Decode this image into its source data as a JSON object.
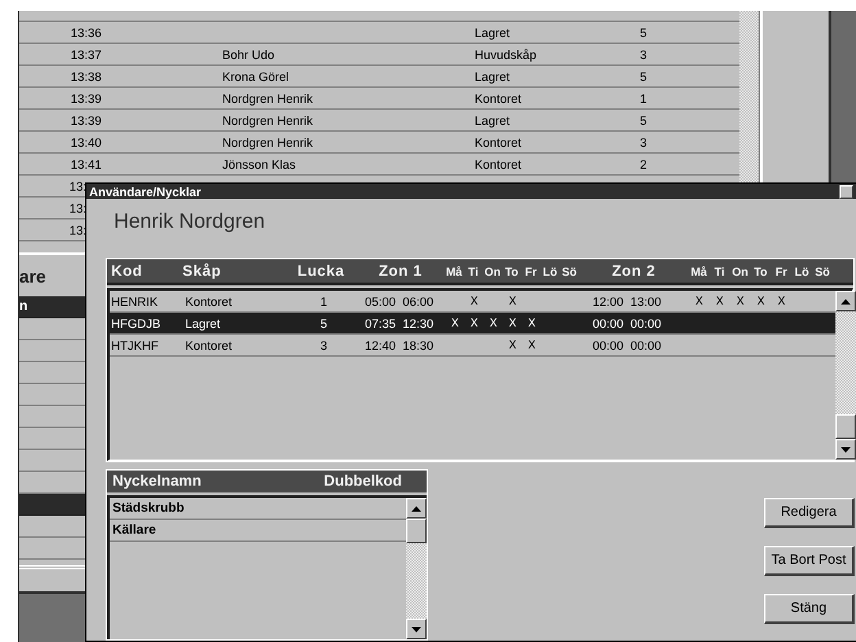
{
  "log_rows": [
    {
      "time": "13:36",
      "place": "Lagret",
      "number": "5"
    },
    {
      "time": "13:37",
      "name": "Bohr Udo",
      "place": "Huvudskåp",
      "number": "3"
    },
    {
      "time": "13:38",
      "name": "Krona Görel",
      "place": "Lagret",
      "number": "5"
    },
    {
      "time": "13:39",
      "name": "Nordgren Henrik",
      "place": "Kontoret",
      "number": "1"
    },
    {
      "time": "13:39",
      "name": "Nordgren Henrik",
      "place": "Lagret",
      "number": "5"
    },
    {
      "time": "13:40",
      "name": "Nordgren Henrik",
      "place": "Kontoret",
      "number": "3"
    },
    {
      "time": "13:41",
      "name": "Jönsson Klas",
      "place": "Kontoret",
      "number": "2"
    }
  ],
  "log_partial_rows": [
    "13:",
    "13:",
    "13:"
  ],
  "side_panel": {
    "title": "are",
    "items": [
      {
        "label": "n",
        "selected": true
      },
      {
        "selected": false
      },
      {
        "selected": false
      },
      {
        "selected": false
      },
      {
        "selected": false
      },
      {
        "selected": false
      },
      {
        "selected": false
      },
      {
        "selected": false
      },
      {
        "selected": false
      },
      {
        "selected": true
      },
      {
        "selected": false
      },
      {
        "selected": false
      }
    ]
  },
  "dialog": {
    "title": "Användare/Nycklar",
    "user_name": "Henrik Nordgren",
    "keys_table": {
      "header": {
        "kod": "Kod",
        "skap": "Skåp",
        "lucka": "Lucka",
        "zon_1": "Zon 1",
        "days_1": [
          "Må",
          "Ti",
          "On",
          "To",
          "Fr",
          "Lö",
          "Sö"
        ],
        "zon_2": "Zon 2",
        "days_2": [
          "Må",
          "Ti",
          "On",
          "To",
          "Fr",
          "Lö",
          "Sö"
        ]
      },
      "rows": [
        {
          "kod": "HENRIK",
          "skap": "Kontoret",
          "lucka": "1",
          "zon_1": "05:00  06:00",
          "days_1": "  X   X",
          "zon_2": "12:00  13:00",
          "days_2": "X X X X X",
          "selected": false
        },
        {
          "kod": "HFGDJB",
          "skap": "Lagret",
          "lucka": "5",
          "zon_1": "07:35  12:30",
          "days_1": "X X X X X",
          "zon_2": "00:00  00:00",
          "selected": true
        },
        {
          "kod": "HTJKHF",
          "skap": "Kontoret",
          "lucka": "3",
          "zon_1": "12:40  18:30",
          "days_1": "      X X",
          "zon_2": "00:00  00:00",
          "selected": false
        }
      ]
    },
    "names_list": {
      "columns": [
        "Nyckelnamn",
        "Dubbelkod"
      ],
      "rows": [
        "Städskrubb",
        "Källare"
      ]
    },
    "buttons": [
      "Redigera",
      "Ta Bort Post",
      "Stäng"
    ]
  }
}
